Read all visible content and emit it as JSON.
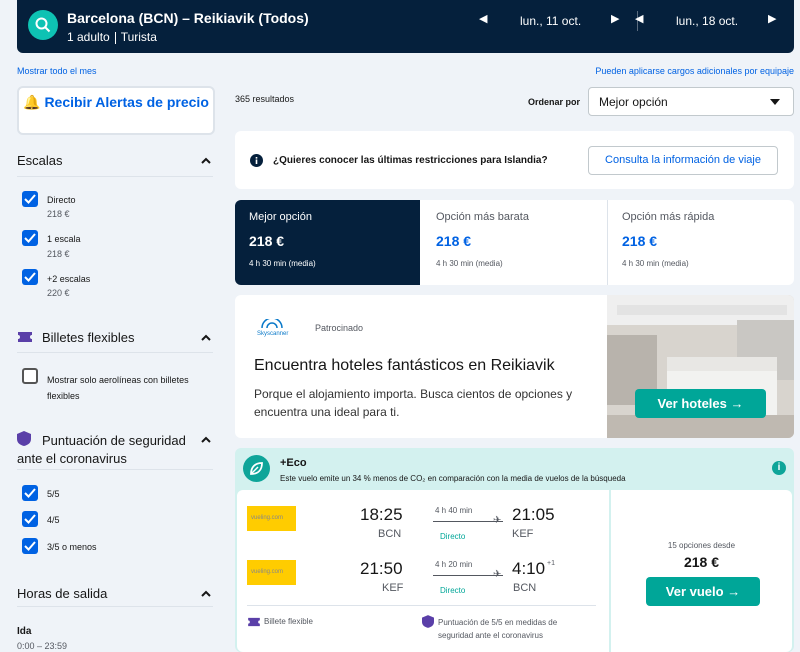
{
  "header": {
    "route": "Barcelona (BCN) – Reikiavik (Todos)",
    "travellers": "1 adulto",
    "cabin": "Turista",
    "depart_date": "lun., 11 oct.",
    "return_date": "lun., 18 oct."
  },
  "links": {
    "show_month": "Mostrar todo el mes",
    "baggage_fees": "Pueden aplicarse cargos adicionales por equipaje"
  },
  "sidebar": {
    "alert_button": "Recibir Alertas de precio",
    "stops": {
      "title": "Escalas",
      "options": [
        {
          "label": "Directo",
          "price": "218 €",
          "checked": true
        },
        {
          "label": "1 escala",
          "price": "218 €",
          "checked": true
        },
        {
          "label": "+2 escalas",
          "price": "220 €",
          "checked": true
        }
      ]
    },
    "flexible": {
      "title": "Billetes flexibles",
      "option": "Mostrar solo aerolíneas con billetes flexibles"
    },
    "safety": {
      "title": "Puntuación de seguridad ante el coronavirus",
      "options": [
        "5/5",
        "4/5",
        "3/5 o menos"
      ]
    },
    "departure": {
      "title": "Horas de salida",
      "leg": "Ida",
      "range": "0:00 – 23:59"
    }
  },
  "results": {
    "count": "365 resultados",
    "sort_label": "Ordenar por",
    "sort_value": "Mejor opción"
  },
  "travel_info": {
    "question": "¿Quieres conocer las últimas restricciones para Islandia?",
    "button": "Consulta la información de viaje"
  },
  "sort_tabs": [
    {
      "label": "Mejor opción",
      "price": "218 €",
      "duration": "4 h 30 min (media)"
    },
    {
      "label": "Opción más barata",
      "price": "218 €",
      "duration": "4 h 30 min (media)"
    },
    {
      "label": "Opción más rápida",
      "price": "218 €",
      "duration": "4 h 30 min (media)"
    }
  ],
  "ad": {
    "brand": "Skyscanner",
    "sponsored": "Patrocinado",
    "title": "Encuentra hoteles fantásticos en Reikiavik",
    "description": "Porque el alojamiento importa. Busca cientos de opciones y encuentra una ideal para ti.",
    "cta": "Ver hoteles →"
  },
  "eco": {
    "title": "+Eco",
    "description": "Este vuelo emite un 34 % menos de CO₂ en comparación con la media de vuelos de la búsqueda"
  },
  "flight": {
    "airline": "vueling.com",
    "outbound": {
      "dep_time": "18:25",
      "dep_airport": "BCN",
      "duration": "4 h 40 min",
      "stops": "Directo",
      "arr_time": "21:05",
      "arr_airport": "KEF"
    },
    "inbound": {
      "dep_time": "21:50",
      "dep_airport": "KEF",
      "duration": "4 h 20 min",
      "stops": "Directo",
      "arr_time": "4:10",
      "arr_plus": "+1",
      "arr_airport": "BCN"
    },
    "flex_tag": "Billete flexible",
    "safety_tag": "Puntuación de 5/5 en medidas de seguridad ante el coronavirus",
    "options": "15 opciones desde",
    "price": "218 €",
    "cta": "Ver vuelo →"
  },
  "colors": {
    "header_bg": "#05203c",
    "link": "#0062e3",
    "accent": "#00a698",
    "eco_bg": "#d3f1ef"
  }
}
